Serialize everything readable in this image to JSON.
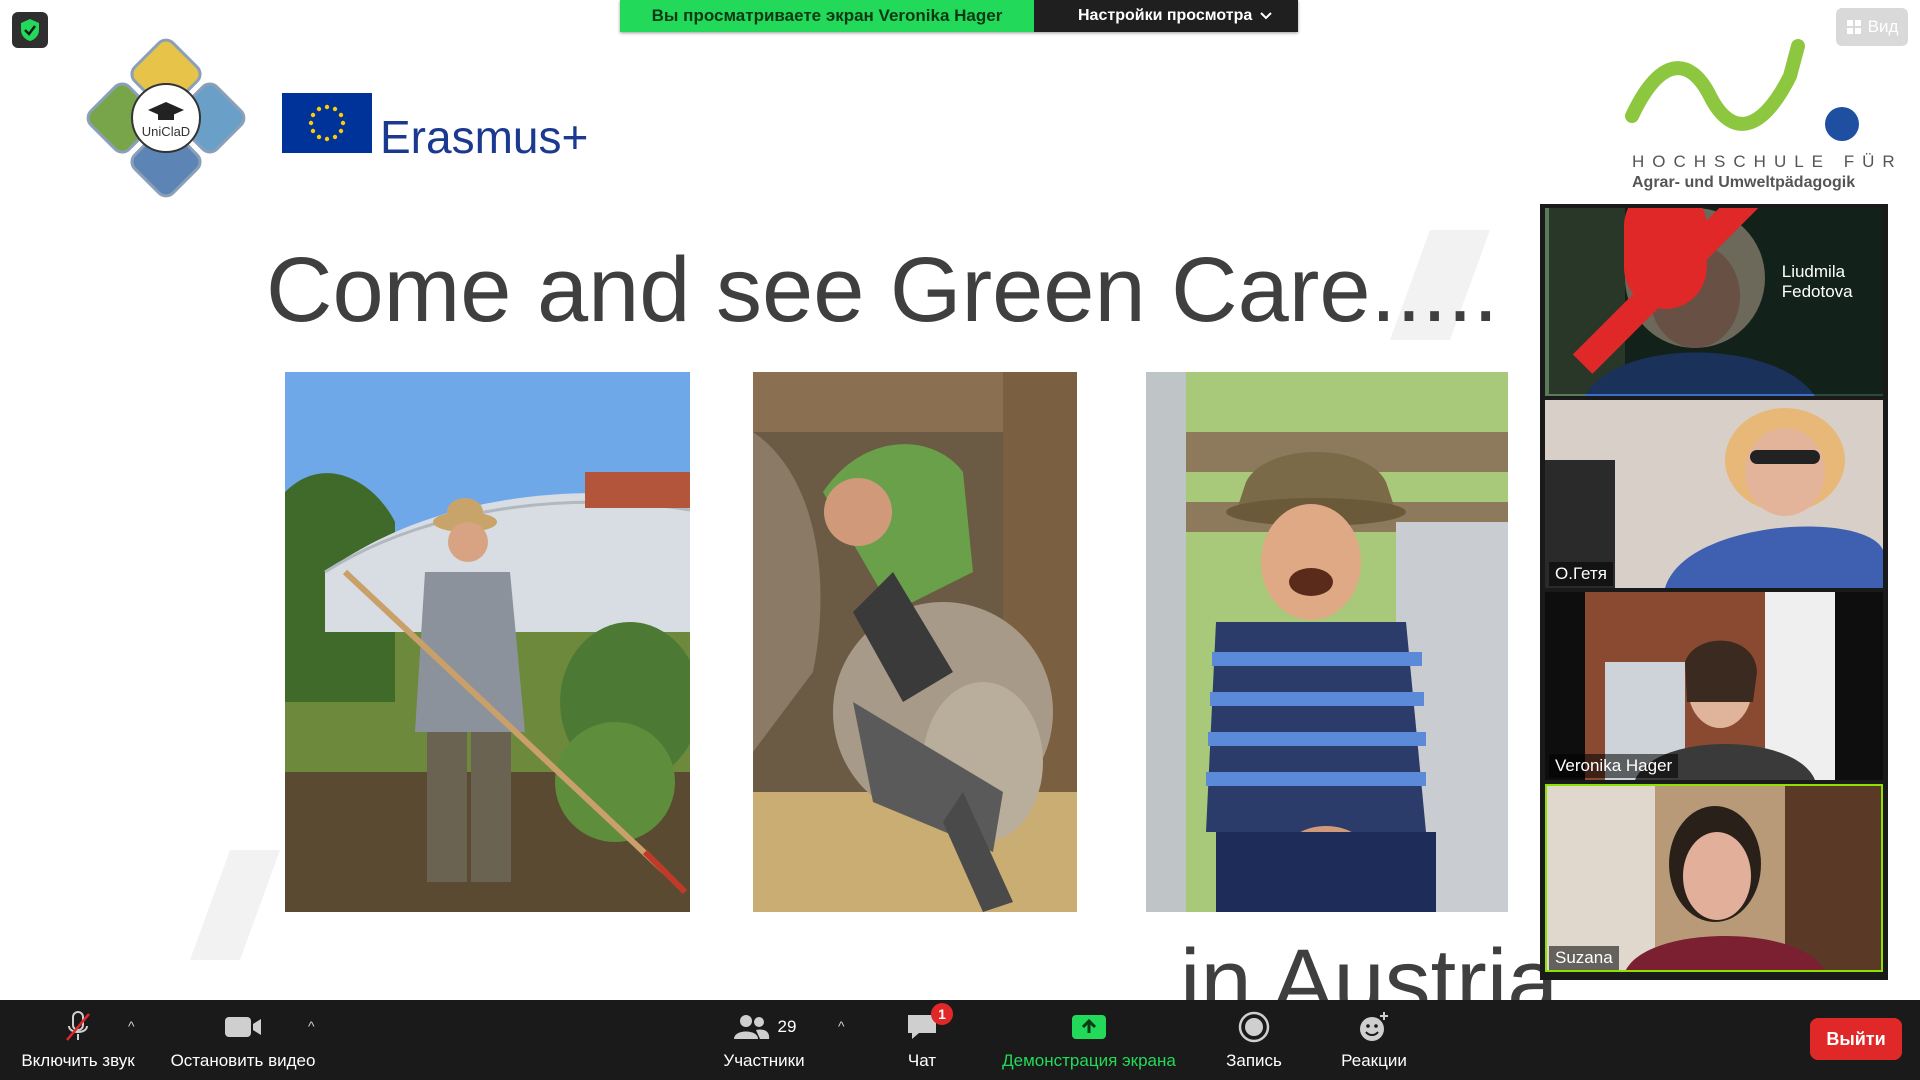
{
  "banner": {
    "status": "Вы просматриваете экран Veronika Hager",
    "settings_label": "Настройки просмотра"
  },
  "view_button": {
    "label": "Вид"
  },
  "slide": {
    "title": "Come and see Green Care.....",
    "subtitle": "in Austria",
    "uniclad_label": "UniClaD",
    "erasmus_label": "Erasmus+",
    "hochschule_line1": "HOCHSCHULE FÜR",
    "hochschule_line2": "Agrar- und Umweltpädagogik"
  },
  "participants_videos": [
    {
      "name": "Liudmila Fedotova",
      "muted": true
    },
    {
      "name": "О.Гетя",
      "muted": false
    },
    {
      "name": "Veronika Hager",
      "muted": false
    },
    {
      "name": "Suzana",
      "muted": false
    }
  ],
  "toolbar": {
    "unmute_label": "Включить звук",
    "stop_video_label": "Остановить видео",
    "participants_label": "Участники",
    "participants_count": "29",
    "chat_label": "Чат",
    "chat_badge": "1",
    "share_label": "Демонстрация экрана",
    "record_label": "Запись",
    "reactions_label": "Реакции",
    "leave_label": "Выйти"
  },
  "colors": {
    "share_green": "#23d959",
    "toolbar_bg": "#1a1a1a",
    "leave_red": "#e02828",
    "active_speaker": "#8ee000"
  }
}
